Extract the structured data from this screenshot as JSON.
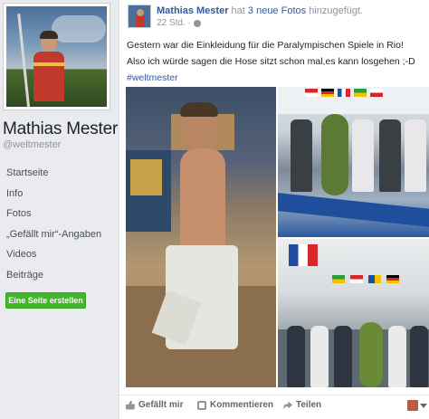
{
  "profile": {
    "name": "Mathias Mester",
    "handle": "@weltmester"
  },
  "nav": {
    "items": [
      "Startseite",
      "Info",
      "Fotos",
      "„Gefällt mir“-Angaben",
      "Videos",
      "Beiträge"
    ],
    "create_page_label": "Eine Seite erstellen"
  },
  "post": {
    "author": "Mathias Mester",
    "action_prefix": "hat",
    "photo_count_label": "3 neue Fotos",
    "action_suffix": "hinzugefügt.",
    "time": "22 Std. ·",
    "line1": "Gestern war die Einkleidung für die Paralympischen Spiele in Rio!",
    "line2": "Also ich würde sagen die Hose sitzt schon mal,es kann losgehen ;-D",
    "hashtag": "#weltmester"
  },
  "footer": {
    "like_label": "Gefällt mir",
    "comment_label": "Kommentieren",
    "share_label": "Teilen"
  },
  "colors": {
    "link": "#365899",
    "accent_green": "#42b72a",
    "meta_gray": "#90949c"
  }
}
